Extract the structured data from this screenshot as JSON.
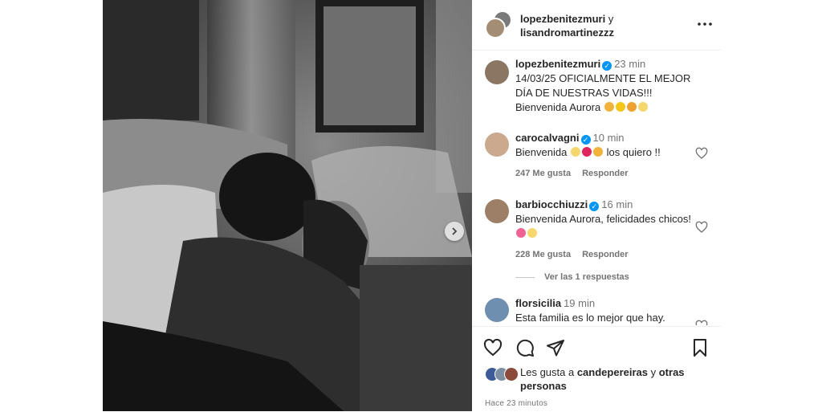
{
  "header": {
    "user1": "lopezbenitezmuri",
    "connector": " y",
    "user2": "lisandromartinezzz"
  },
  "caption": {
    "username": "lopezbenitezmuri",
    "time": "23 min",
    "text": "14/03/25 OFICIALMENTE EL MEJOR DÍA DE NUESTRAS VIDAS!!! Bienvenida Aurora"
  },
  "comments": [
    {
      "username": "carocalvagni",
      "verified": true,
      "time": "10 min",
      "text": "Bienvenida",
      "text_tail": "los quiero !!",
      "likes": "247 Me gusta",
      "reply": "Responder"
    },
    {
      "username": "barbiocchiuzzi",
      "verified": true,
      "time": "16 min",
      "text": "Bienvenida Aurora, felicidades chicos!",
      "likes": "228 Me gusta",
      "reply": "Responder"
    },
    {
      "username": "florsicilia",
      "verified": false,
      "time": "19 min",
      "text": "Esta familia es lo mejor que hay."
    }
  ],
  "view_replies": "Ver las 1 respuestas",
  "likes_line": {
    "prefix": "Les gusta a ",
    "user": "candepereiras",
    "middle": " y ",
    "suffix": "otras personas"
  },
  "posted_ago": "Hace 23 minutos",
  "icons": [
    "heart-icon",
    "comment-icon",
    "share-icon",
    "bookmark-icon",
    "more-icon",
    "chevron-right-icon",
    "verified-icon"
  ],
  "colors": {
    "verified": "#0095f6",
    "muted": "#737373",
    "text": "#262626"
  }
}
